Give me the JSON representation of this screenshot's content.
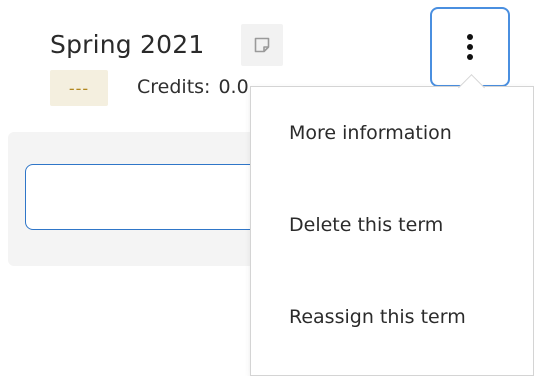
{
  "term": {
    "title": "Spring 2021",
    "status_badge": "---",
    "credits_label": "Credits:",
    "credits_value": "0.0"
  },
  "icons": {
    "note": "note-icon",
    "menu": "vertical-ellipsis-icon"
  },
  "menu": {
    "items": [
      {
        "label": "More information"
      },
      {
        "label": "Delete this term"
      },
      {
        "label": "Reassign this term"
      }
    ]
  },
  "colors": {
    "accent": "#2f76c8",
    "badge_bg": "#f4efdf",
    "badge_text": "#b1871f"
  }
}
